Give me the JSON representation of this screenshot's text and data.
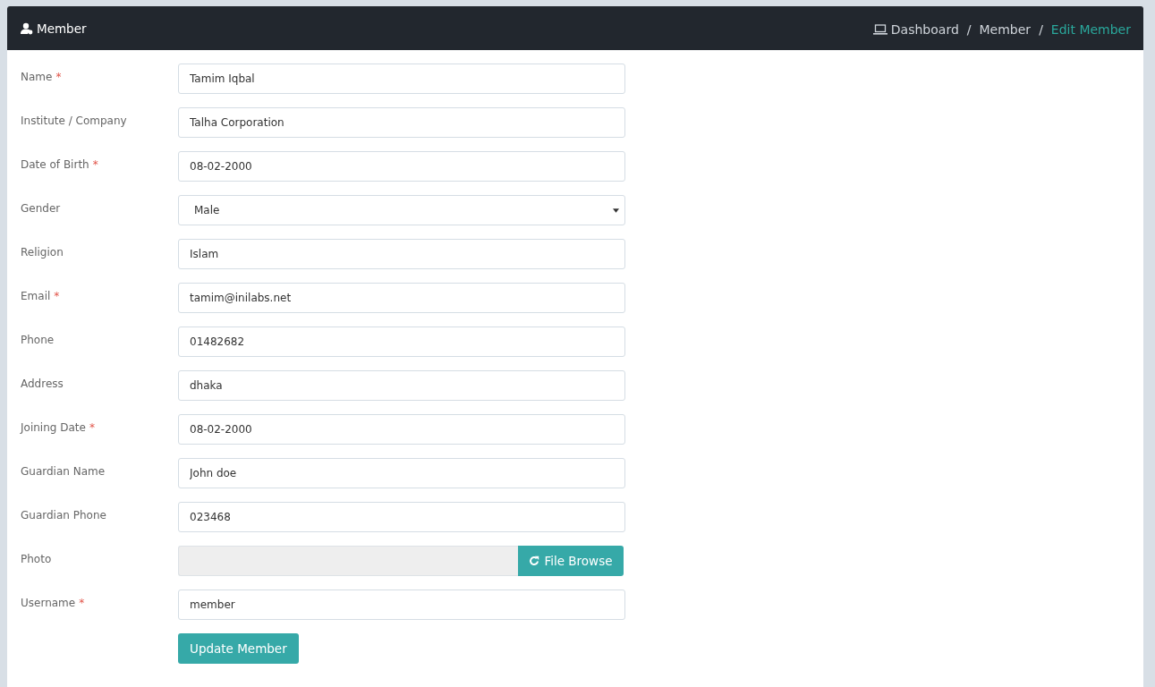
{
  "header": {
    "title": "Member",
    "breadcrumb": [
      {
        "label": "Dashboard",
        "active": false,
        "icon": true
      },
      {
        "label": "Member",
        "active": false,
        "separator": "/"
      },
      {
        "label": "Edit Member",
        "active": true,
        "separator": "/"
      }
    ]
  },
  "form": {
    "fields": [
      {
        "kind": "text",
        "label": "Name",
        "marker": "*",
        "value": "Tamim Iqbal"
      },
      {
        "kind": "text",
        "label": "Institute / Company",
        "value": "Talha Corporation"
      },
      {
        "kind": "text",
        "label": "Date of Birth",
        "marker": "*",
        "value": "08-02-2000"
      },
      {
        "kind": "select",
        "label": "Gender",
        "value": "Male"
      },
      {
        "kind": "text",
        "label": "Religion",
        "value": "Islam"
      },
      {
        "kind": "text",
        "label": "Email",
        "marker": "*",
        "value": "tamim@inilabs.net"
      },
      {
        "kind": "text",
        "label": "Phone",
        "value": "01482682"
      },
      {
        "kind": "text",
        "label": "Address",
        "value": "dhaka"
      },
      {
        "kind": "text",
        "label": "Joining Date",
        "marker": "*",
        "value": "08-02-2000"
      },
      {
        "kind": "text",
        "label": "Guardian Name",
        "value": "John doe"
      },
      {
        "kind": "text",
        "label": "Guardian Phone",
        "value": "023468"
      },
      {
        "kind": "file",
        "label": "Photo",
        "button": "File Browse"
      },
      {
        "kind": "text",
        "label": "Username",
        "marker": "*",
        "value": "member"
      }
    ],
    "submit": "Update Member"
  }
}
